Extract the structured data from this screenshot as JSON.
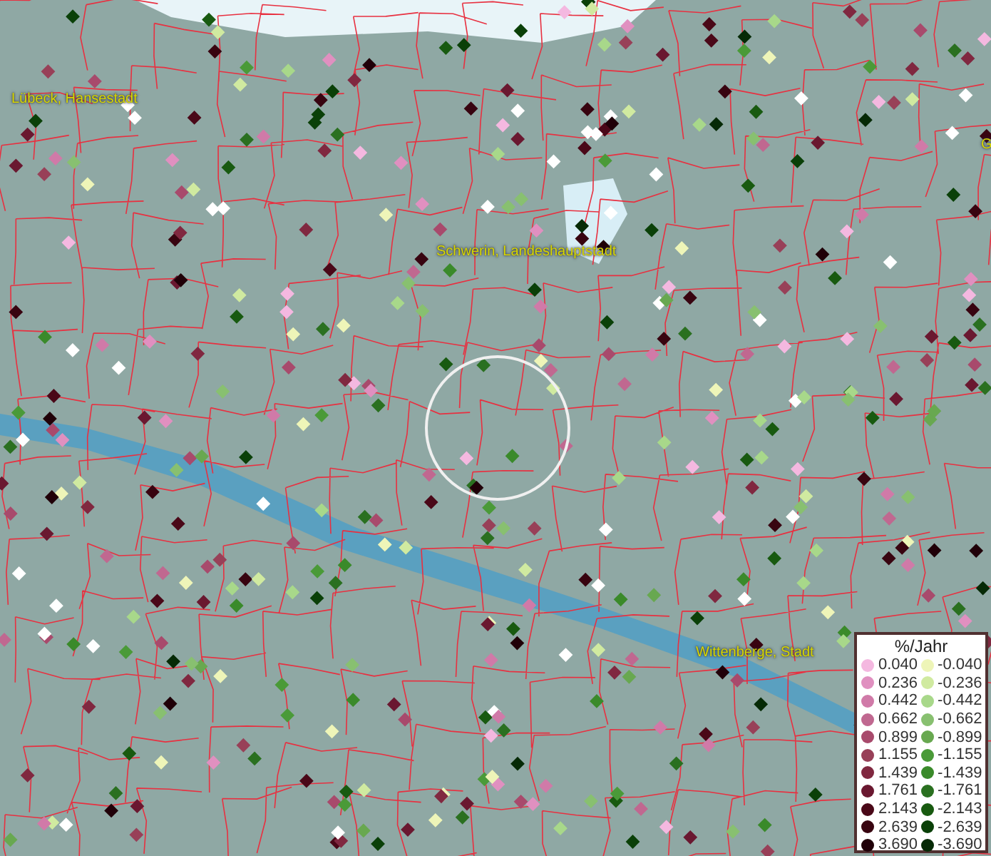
{
  "places": [
    {
      "name": "Lübeck, Hansestadt"
    },
    {
      "name": "Schwerin, Landeshauptstadt"
    },
    {
      "name": "Wittenberge, Stadt"
    },
    {
      "name": "G"
    }
  ],
  "legend": {
    "title": "%/Jahr",
    "positive": [
      {
        "value": "0.040",
        "color": "#f4b8e0"
      },
      {
        "value": "0.236",
        "color": "#e090c0"
      },
      {
        "value": "0.442",
        "color": "#d07aa8"
      },
      {
        "value": "0.662",
        "color": "#c06890"
      },
      {
        "value": "0.899",
        "color": "#a84a6c"
      },
      {
        "value": "1.155",
        "color": "#984058"
      },
      {
        "value": "1.439",
        "color": "#802840"
      },
      {
        "value": "1.761",
        "color": "#6a1830"
      },
      {
        "value": "2.143",
        "color": "#4a0818"
      },
      {
        "value": "2.639",
        "color": "#380410"
      },
      {
        "value": "3.690",
        "color": "#200008"
      }
    ],
    "negative": [
      {
        "value": "-0.040",
        "color": "#eef5b8"
      },
      {
        "value": "-0.236",
        "color": "#d0eaa0"
      },
      {
        "value": "-0.442",
        "color": "#a8d88a"
      },
      {
        "value": "-0.662",
        "color": "#88c070"
      },
      {
        "value": "-0.899",
        "color": "#68a850"
      },
      {
        "value": "-1.155",
        "color": "#4a9a38"
      },
      {
        "value": "-1.439",
        "color": "#3a8a2a"
      },
      {
        "value": "-1.761",
        "color": "#2a7020"
      },
      {
        "value": "-2.143",
        "color": "#185a10"
      },
      {
        "value": "-2.639",
        "color": "#0a4008"
      },
      {
        "value": "-3.690",
        "color": "#062a06"
      }
    ]
  }
}
